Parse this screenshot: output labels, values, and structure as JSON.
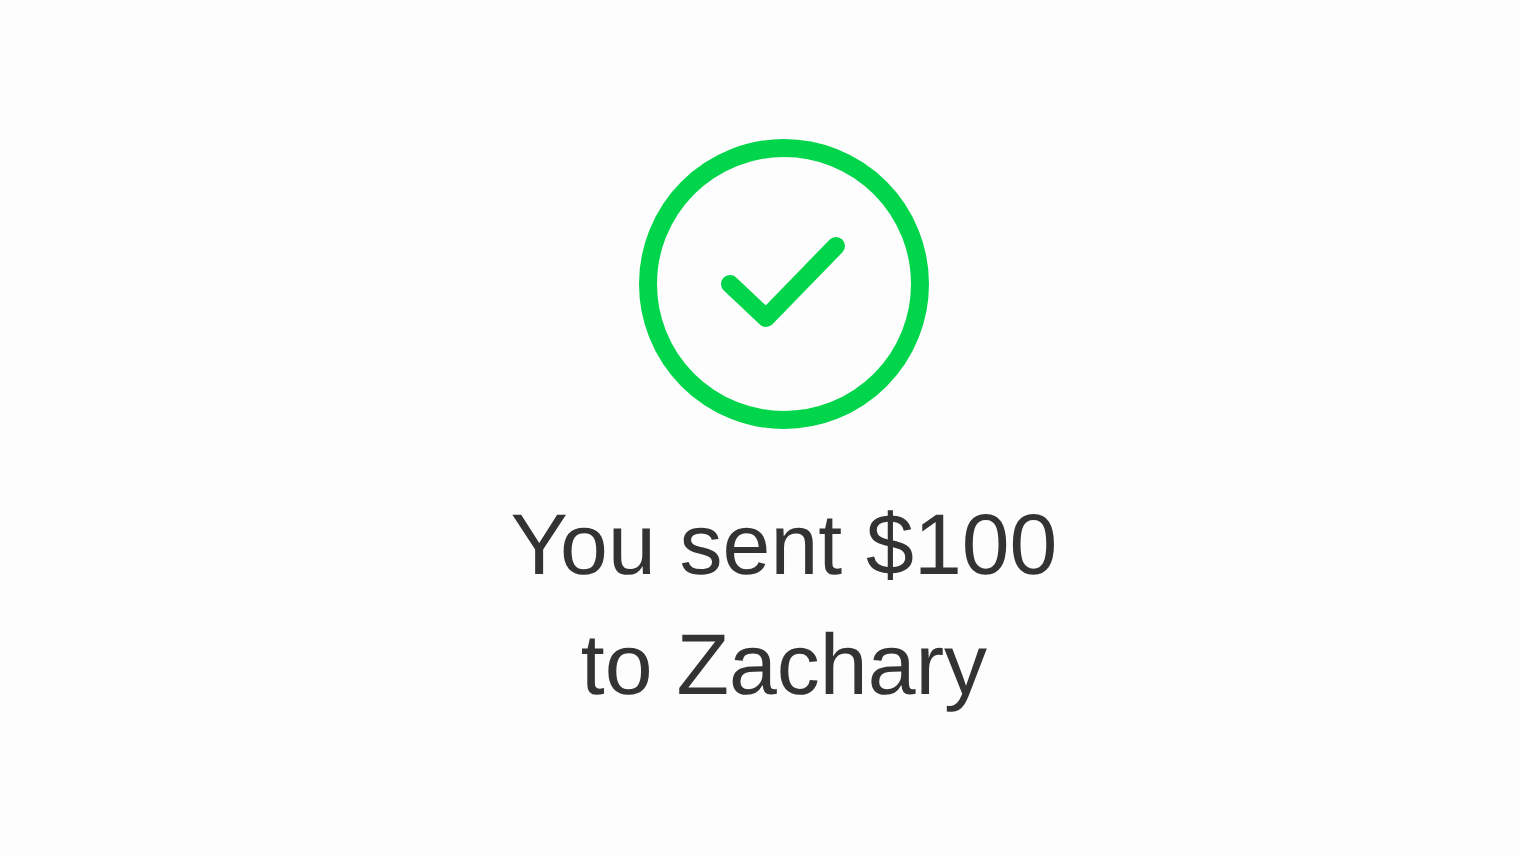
{
  "confirmation": {
    "kind": "success",
    "message": "You sent $100 to Zachary"
  }
}
